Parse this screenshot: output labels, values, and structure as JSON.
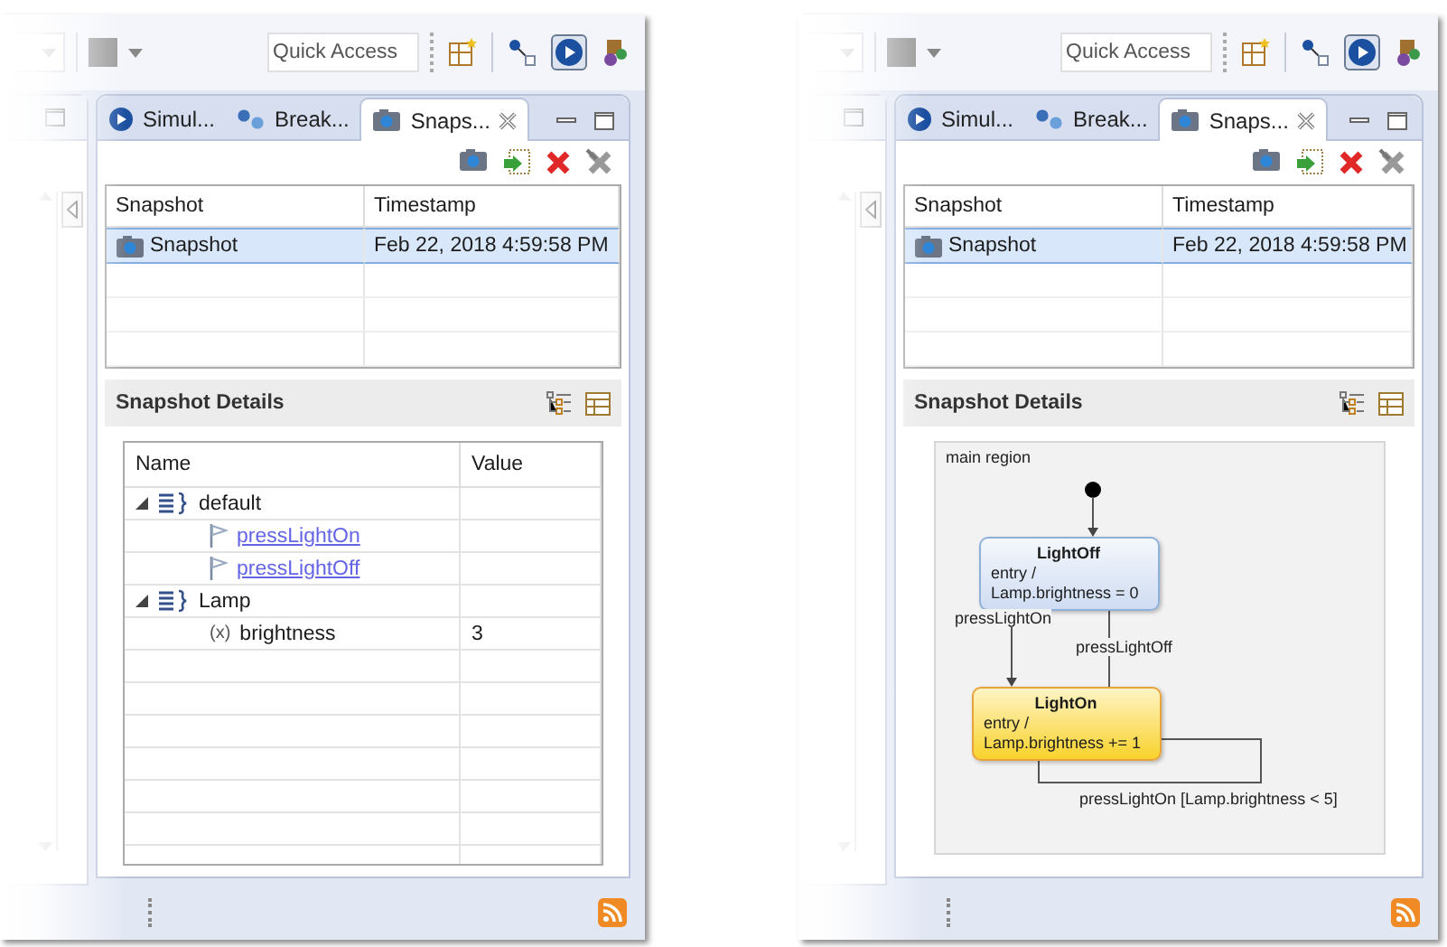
{
  "panels": [
    {
      "toolbar": {
        "quick_access": {
          "placeholder": "Quick Access"
        }
      },
      "tabs": [
        {
          "label": "Simul...",
          "kind": "simulation",
          "selected": false
        },
        {
          "label": "Break...",
          "kind": "breakpoints",
          "selected": false
        },
        {
          "label": "Snaps...",
          "kind": "snapshots",
          "selected": true
        }
      ],
      "snapshot_table": {
        "columns": [
          "Snapshot",
          "Timestamp"
        ],
        "rows": [
          {
            "cells": [
              "Snapshot",
              "Feb 22, 2018 4:59:58 PM"
            ],
            "selected": true
          }
        ]
      },
      "details": {
        "title": "Snapshot Details",
        "kind": "tree",
        "columns": [
          "Name",
          "Value"
        ],
        "nodes": [
          {
            "kind": "scope",
            "name": "default",
            "expanded": true,
            "children": [
              {
                "kind": "event",
                "name": "pressLightOn"
              },
              {
                "kind": "event",
                "name": "pressLightOff"
              }
            ]
          },
          {
            "kind": "scope",
            "name": "Lamp",
            "expanded": true,
            "children": [
              {
                "kind": "variable",
                "symbol": "(x)",
                "name": "brightness",
                "value": "3"
              }
            ]
          }
        ]
      }
    },
    {
      "toolbar": {
        "quick_access": {
          "placeholder": "Quick Access"
        }
      },
      "tabs": [
        {
          "label": "Simul...",
          "kind": "simulation",
          "selected": false
        },
        {
          "label": "Break...",
          "kind": "breakpoints",
          "selected": false
        },
        {
          "label": "Snaps...",
          "kind": "snapshots",
          "selected": true
        }
      ],
      "snapshot_table": {
        "columns": [
          "Snapshot",
          "Timestamp"
        ],
        "rows": [
          {
            "cells": [
              "Snapshot",
              "Feb 22, 2018 4:59:58 PM"
            ],
            "selected": true
          }
        ]
      },
      "details": {
        "title": "Snapshot Details",
        "kind": "diagram",
        "region": "main region",
        "states": [
          {
            "name": "LightOff",
            "entry": "entry /",
            "action": "Lamp.brightness = 0",
            "active": false
          },
          {
            "name": "LightOn",
            "entry": "entry /",
            "action": "Lamp.brightness += 1",
            "active": true
          }
        ],
        "transitions": [
          {
            "label": "pressLightOn"
          },
          {
            "label": "pressLightOff"
          },
          {
            "label": "pressLightOn [Lamp.brightness < 5]"
          }
        ]
      }
    }
  ]
}
